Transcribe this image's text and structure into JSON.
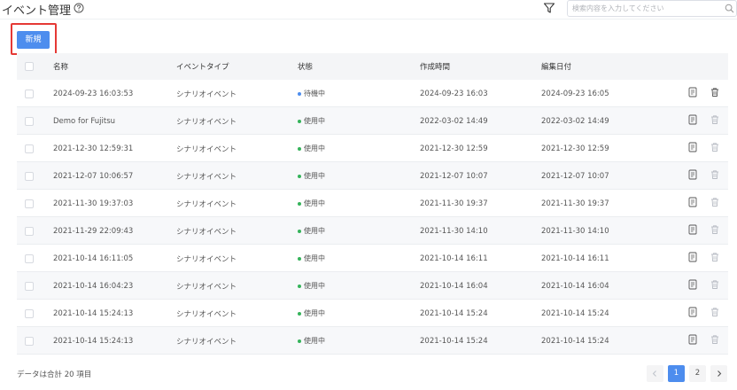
{
  "header": {
    "title": "イベント管理",
    "search_placeholder": "検索内容を入力してください"
  },
  "toolbar": {
    "new_label": "新規"
  },
  "table": {
    "columns": [
      "名称",
      "イベントタイプ",
      "状態",
      "作成時間",
      "編集日付"
    ],
    "rows": [
      {
        "name": "2024-09-23 16:03:53",
        "type": "シナリオイベント",
        "status": "待機中",
        "status_color": "#4d8dee",
        "created": "2024-09-23 16:03",
        "edited": "2024-09-23 16:05",
        "delete_active": true
      },
      {
        "name": "Demo for Fujitsu",
        "type": "シナリオイベント",
        "status": "使用中",
        "status_color": "#35b35a",
        "created": "2022-03-02 14:49",
        "edited": "2022-03-02 14:49",
        "delete_active": false
      },
      {
        "name": "2021-12-30 12:59:31",
        "type": "シナリオイベント",
        "status": "使用中",
        "status_color": "#35b35a",
        "created": "2021-12-30 12:59",
        "edited": "2021-12-30 12:59",
        "delete_active": false
      },
      {
        "name": "2021-12-07 10:06:57",
        "type": "シナリオイベント",
        "status": "使用中",
        "status_color": "#35b35a",
        "created": "2021-12-07 10:07",
        "edited": "2021-12-07 10:07",
        "delete_active": false
      },
      {
        "name": "2021-11-30 19:37:03",
        "type": "シナリオイベント",
        "status": "使用中",
        "status_color": "#35b35a",
        "created": "2021-11-30 19:37",
        "edited": "2021-11-30 19:37",
        "delete_active": false
      },
      {
        "name": "2021-11-29 22:09:43",
        "type": "シナリオイベント",
        "status": "使用中",
        "status_color": "#35b35a",
        "created": "2021-11-30 14:10",
        "edited": "2021-11-30 14:10",
        "delete_active": false
      },
      {
        "name": "2021-10-14 16:11:05",
        "type": "シナリオイベント",
        "status": "使用中",
        "status_color": "#35b35a",
        "created": "2021-10-14 16:11",
        "edited": "2021-10-14 16:11",
        "delete_active": false
      },
      {
        "name": "2021-10-14 16:04:23",
        "type": "シナリオイベント",
        "status": "使用中",
        "status_color": "#35b35a",
        "created": "2021-10-14 16:04",
        "edited": "2021-10-14 16:04",
        "delete_active": false
      },
      {
        "name": "2021-10-14 15:24:13",
        "type": "シナリオイベント",
        "status": "使用中",
        "status_color": "#35b35a",
        "created": "2021-10-14 15:24",
        "edited": "2021-10-14 15:24",
        "delete_active": false
      },
      {
        "name": "2021-10-14 15:24:13",
        "type": "シナリオイベント",
        "status": "使用中",
        "status_color": "#35b35a",
        "created": "2021-10-14 15:24",
        "edited": "2021-10-14 15:24",
        "delete_active": false
      }
    ]
  },
  "footer": {
    "total_text": "データは合計 20 項目",
    "pages": [
      "1",
      "2"
    ],
    "current_page": "1"
  },
  "colors": {
    "accent": "#4d8dee",
    "highlight_border": "#e53935",
    "active_icon": "#555555",
    "inactive_icon": "#b8bcc4"
  },
  "icons": {
    "help": "question-circle-icon",
    "filter": "funnel-filter-icon",
    "search": "magnifier-search-icon",
    "edit": "document-edit-icon",
    "delete": "trash-icon",
    "prev": "chevron-left-icon",
    "next": "chevron-right-icon"
  }
}
